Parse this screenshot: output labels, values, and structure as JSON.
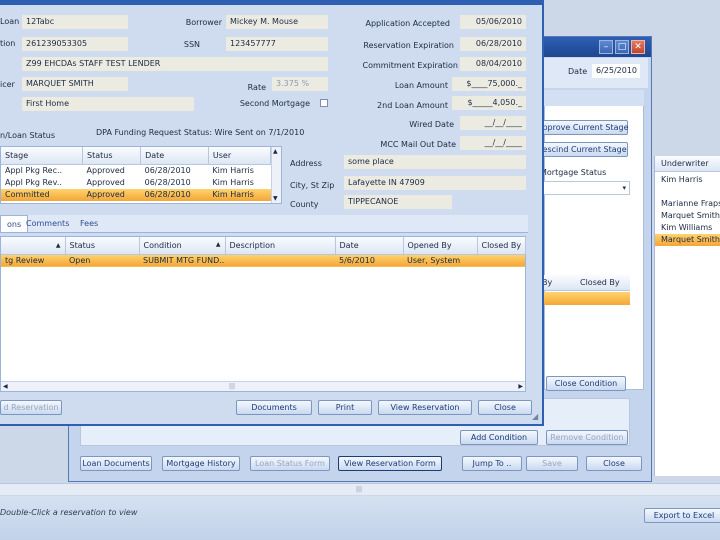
{
  "back_window": {
    "date_label": "Date",
    "date_value": "6/25/2010",
    "buttons": {
      "approve_stage": "Approve Current Stage",
      "rescind_stage": "Rescind Current Stage"
    },
    "mortgage_status_label": "Mortgage Status",
    "underwriter": {
      "header": "Underwriter",
      "items": [
        "Kim Harris",
        "",
        "Marianne Fraps",
        "Marquet Smith",
        "Kim Williams",
        "Marquet Smith"
      ],
      "selected_index": 5
    },
    "closed_by_header": "Closed By",
    "by_header": "By",
    "close_condition": "Close Condition",
    "add_condition": "Add Condition",
    "remove_condition": "Remove Condition",
    "bottom_buttons": {
      "loan_documents": "Loan Documents",
      "mortgage_history": "Mortgage History",
      "loan_status_form": "Loan Status Form",
      "view_reservation_form": "View Reservation Form",
      "jump_to": "Jump To ..",
      "save": "Save",
      "close": "Close"
    }
  },
  "status_bar": {
    "hint": "Double-Click a reservation to view",
    "export": "Export to Excel"
  },
  "front_window": {
    "fields": {
      "loan_label": "Loan",
      "loan_value": "12Tabc",
      "tion_label": "tion",
      "tion_value": "261239053305",
      "lender_value": "Z99 EHCDAs STAFF TEST LENDER",
      "officer_label": "icer",
      "officer_value": "MARQUET SMITH",
      "first_home_value": "First Home",
      "borrower_label": "Borrower",
      "borrower_value": "Mickey M. Mouse",
      "ssn_label": "SSN",
      "ssn_value": "123457777",
      "rate_label": "Rate",
      "rate_value": "3.375 %",
      "second_mortgage_label": "Second Mortgage",
      "app_accepted_label": "Application Accepted",
      "app_accepted_value": "05/06/2010",
      "res_exp_label": "Reservation Expiration",
      "res_exp_value": "06/28/2010",
      "commit_exp_label": "Commitment Expiration",
      "commit_exp_value": "08/04/2010",
      "loan_amount_label": "Loan Amount",
      "loan_amount_value": "$____75,000._",
      "second_loan_label": "2nd Loan Amount",
      "second_loan_value": "$_____4,050._",
      "wired_date_label": "Wired Date",
      "wired_date_value": "__/__/____",
      "mcc_label": "MCC Mail Out Date",
      "mcc_value": "__/__/____",
      "loan_status_label": "n/Loan Status",
      "dpa_label": "DPA Funding Request Status: Wire Sent on 7/1/2010",
      "address_label": "Address",
      "address_value": "some place",
      "city_label": "City, St Zip",
      "city_value": "Lafayette IN  47909",
      "county_label": "County",
      "county_value": "TIPPECANOE"
    },
    "stages": {
      "headers": [
        "Stage",
        "Status",
        "Date",
        "User"
      ],
      "rows": [
        [
          "Appl Pkg Rec..",
          "Approved",
          "06/28/2010",
          "Kim Harris"
        ],
        [
          "Appl Pkg Rev..",
          "Approved",
          "06/28/2010",
          "Kim Harris"
        ],
        [
          "Committed",
          "Approved",
          "06/28/2010",
          "Kim Harris"
        ]
      ]
    },
    "tabs": [
      "ons",
      "Comments",
      "Fees"
    ],
    "conditions": {
      "headers": [
        "",
        "Status",
        "Condition",
        "Description",
        "Date",
        "Opened By",
        "Closed By"
      ],
      "rows": [
        [
          "tg Review",
          "Open",
          "SUBMIT MTG FUND..",
          "",
          "5/6/2010",
          "User, System",
          ""
        ]
      ]
    },
    "buttons": {
      "add_reservation": "d Reservation",
      "documents": "Documents",
      "print": "Print",
      "view_reservation": "View Reservation",
      "close": "Close"
    }
  }
}
